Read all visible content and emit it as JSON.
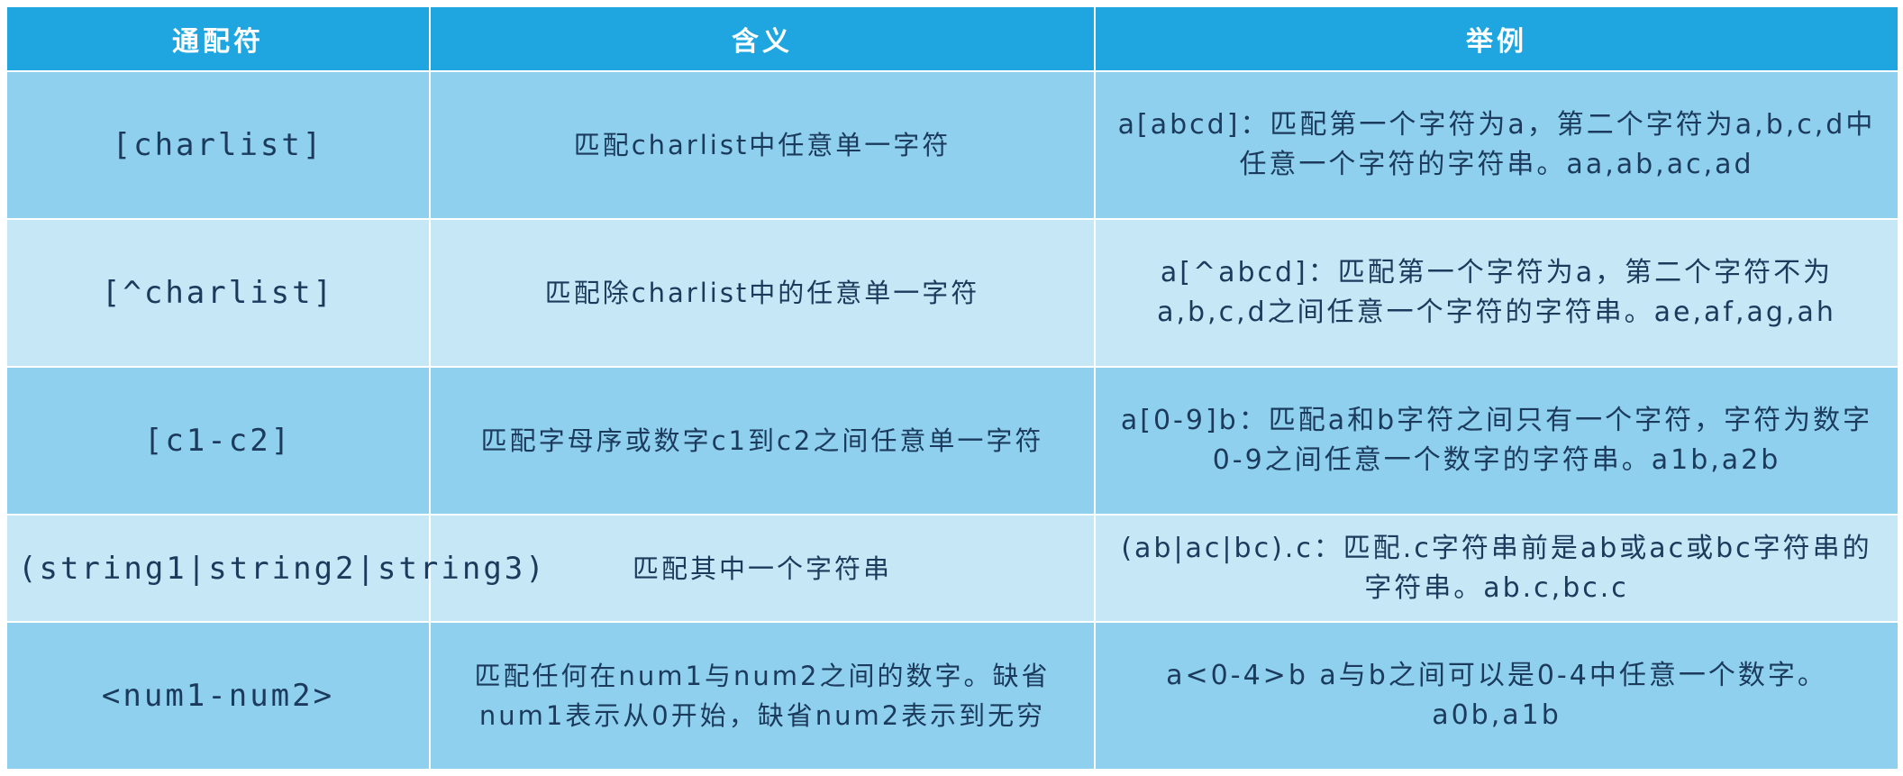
{
  "header": {
    "wildcard": "通配符",
    "meaning": "含义",
    "example": "举例"
  },
  "rows": [
    {
      "wildcard": "[charlist]",
      "meaning": "匹配charlist中任意单一字符",
      "example": "a[abcd]：匹配第一个字符为a，第二个字符为a,b,c,d中任意一个字符的字符串。aa,ab,ac,ad"
    },
    {
      "wildcard": "[^charlist]",
      "meaning": "匹配除charlist中的任意单一字符",
      "example": "a[^abcd]：匹配第一个字符为a，第二个字符不为a,b,c,d之间任意一个字符的字符串。ae,af,ag,ah"
    },
    {
      "wildcard": "[c1-c2]",
      "meaning": "匹配字母序或数字c1到c2之间任意单一字符",
      "example": "a[0-9]b：匹配a和b字符之间只有一个字符，字符为数字0-9之间任意一个数字的字符串。a1b,a2b"
    },
    {
      "wildcard": "(string1|string2|string3)",
      "meaning": "匹配其中一个字符串",
      "example": "(ab|ac|bc).c：匹配.c字符串前是ab或ac或bc字符串的字符串。ab.c,bc.c"
    },
    {
      "wildcard": "<num1-num2>",
      "meaning": "匹配任何在num1与num2之间的数字。缺省num1表示从0开始，缺省num2表示到无穷",
      "example": "a<0-4>b a与b之间可以是0-4中任意一个数字。a0b,a1b"
    }
  ]
}
